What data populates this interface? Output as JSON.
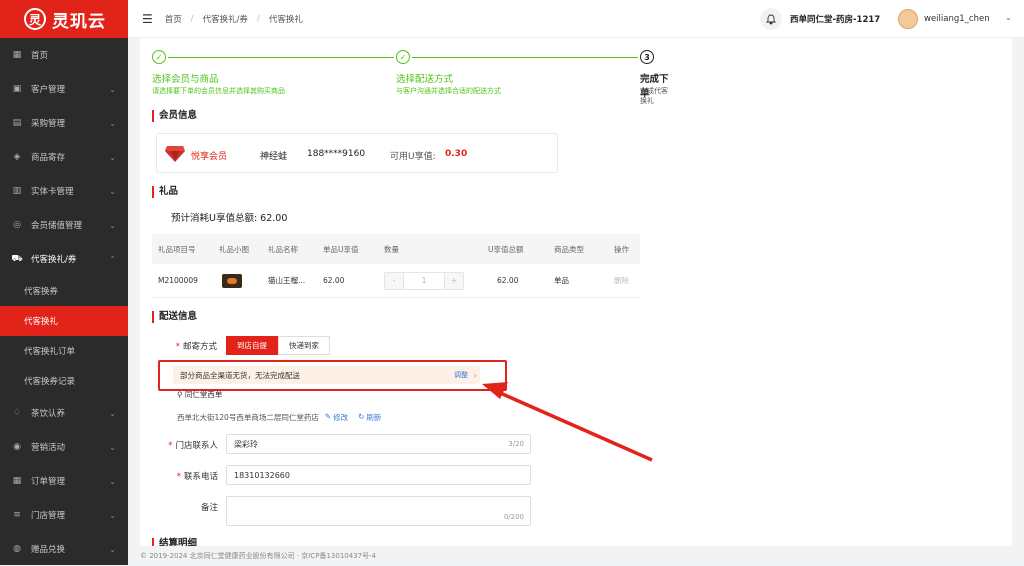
{
  "app": {
    "logo_glyph": "灵",
    "name": "灵玑云",
    "brand_color": "#e2231a"
  },
  "sidebar": {
    "items": [
      {
        "label": "首页",
        "icon": "grid-icon",
        "glyph": "▦"
      },
      {
        "label": "客户管理",
        "icon": "user-box-icon",
        "glyph": "▣"
      },
      {
        "label": "采购管理",
        "icon": "briefcase-icon",
        "glyph": "▤"
      },
      {
        "label": "商品寄存",
        "icon": "cube-icon",
        "glyph": "◈"
      },
      {
        "label": "实体卡管理",
        "icon": "book-icon",
        "glyph": "▥"
      },
      {
        "label": "会员储值管理",
        "icon": "coin-icon",
        "glyph": "◎"
      },
      {
        "label": "代客换礼/券",
        "icon": "cart-icon",
        "glyph": "⛟"
      },
      {
        "label": "茶饮认养",
        "icon": "leaf-icon",
        "glyph": "♢"
      },
      {
        "label": "营销活动",
        "icon": "megaphone-icon",
        "glyph": "◉"
      },
      {
        "label": "订单管理",
        "icon": "grid-icon",
        "glyph": "▦"
      },
      {
        "label": "门店管理",
        "icon": "list-icon",
        "glyph": "≡"
      },
      {
        "label": "赠品兑换",
        "icon": "gift-icon",
        "glyph": "◍"
      }
    ],
    "sub_items": [
      "代客换券",
      "代客换礼",
      "代客换礼订单",
      "代客换券记录"
    ]
  },
  "topbar": {
    "breadcrumbs": [
      "首页",
      "代客换礼/券",
      "代客换礼"
    ],
    "store": "西单同仁堂-药房-1217",
    "user": "weiliang1_chen"
  },
  "steps": [
    {
      "num": "✓",
      "title": "选择会员与商品",
      "desc": "请选择要下单的会员信息并选择其购买商品"
    },
    {
      "num": "✓",
      "title": "选择配送方式",
      "desc": "与客户沟通并选择合适的配送方式"
    },
    {
      "num": "3",
      "title": "完成下单",
      "desc": "完成代客换礼"
    }
  ],
  "member": {
    "section": "会员信息",
    "level": "悦享会员",
    "name": "神经蛙",
    "phone": "188****9160",
    "u_label": "可用U享值:",
    "u_value": "0.30"
  },
  "gift": {
    "section": "礼品",
    "total": "预计消耗U享值总额: 62.00",
    "headers": [
      "礼品项目号",
      "礼品小图",
      "礼品名称",
      "单品U享值",
      "数量",
      "U享值总额",
      "商品类型",
      "操作"
    ],
    "row": {
      "code": "M2100009",
      "name": "猫山王榴...",
      "unit": "62.00",
      "minus": "-",
      "qty": "1",
      "plus": "+",
      "total": "62.00",
      "type": "单品",
      "action": "删除"
    }
  },
  "delivery": {
    "section": "配送信息",
    "method_label": "邮寄方式",
    "options": [
      "到店自提",
      "快递到家"
    ],
    "warning": "部分商品全渠道无货，无法完成配送",
    "adjust": "调整",
    "store_name": "同仁堂西单",
    "address": "西单北大街120号西单商场二层同仁堂药店",
    "edit": "修改",
    "refresh": "刷新",
    "contact_label": "门店联系人",
    "contact_value": "梁彩玲",
    "contact_count": "3/20",
    "phone_label": "联系电话",
    "phone_value": "18310132660",
    "remark_label": "备注",
    "remark_count": "0/200"
  },
  "settlement": {
    "section": "结算明细"
  },
  "footer": "© 2019-2024 北京同仁堂健康药业股份有限公司 · 京ICP备13010437号-4"
}
